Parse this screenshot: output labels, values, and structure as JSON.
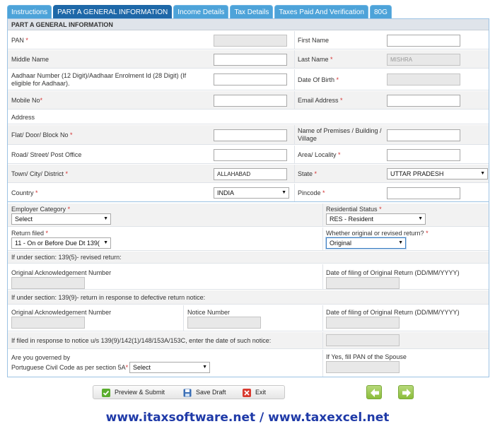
{
  "tabs": [
    "Instructions",
    "PART A GENERAL INFORMATION",
    "Income Details",
    "Tax Details",
    "Taxes Paid And Verification",
    "80G"
  ],
  "section_title": "PART A GENERAL INFORMATION",
  "fields": {
    "pan": {
      "label": "PAN",
      "value": "",
      "required": "*"
    },
    "first_name": {
      "label": "First Name",
      "value": ""
    },
    "middle_name": {
      "label": "Middle Name",
      "value": ""
    },
    "last_name": {
      "label": "Last Name",
      "value": "MISHRA",
      "required": "*"
    },
    "aadhaar": {
      "label": "Aadhaar Number (12 Digit)/Aadhaar Enrolment Id (28 Digit) (If eligible for Aadhaar).",
      "value": ""
    },
    "dob": {
      "label": "Date Of Birth",
      "value": "",
      "required": "*"
    },
    "mobile": {
      "label": "Mobile No",
      "value": "",
      "required": "*"
    },
    "email": {
      "label": "Email Address",
      "value": "",
      "required": "*"
    },
    "address_label": "Address",
    "flat": {
      "label": "Flat/ Door/ Block No",
      "value": "",
      "required": "*"
    },
    "premises": {
      "label": "Name of Premises / Building / Village",
      "value": ""
    },
    "road": {
      "label": "Road/ Street/ Post Office",
      "value": ""
    },
    "area": {
      "label": "Area/ Locality",
      "value": "",
      "required": "*"
    },
    "town": {
      "label": "Town/ City/ District",
      "value": "ALLAHABAD",
      "required": "*"
    },
    "state": {
      "label": "State",
      "value": "UTTAR PRADESH",
      "required": "*"
    },
    "country": {
      "label": "Country",
      "value": "INDIA",
      "required": "*"
    },
    "pincode": {
      "label": "Pincode",
      "value": "",
      "required": "*"
    }
  },
  "filing": {
    "employer_category": {
      "label": "Employer Category",
      "value": "Select",
      "required": "*"
    },
    "residential_status": {
      "label": "Residential Status",
      "value": "RES - Resident",
      "required": "*"
    },
    "return_filed": {
      "label": "Return filed",
      "value": "11 - On or Before Due Dt 139(",
      "required": "*"
    },
    "original_revised": {
      "label": "Whether original or revised return?",
      "value": "Original",
      "required": "*"
    },
    "revised_heading": "If under section: 139(5)- revised return:",
    "orig_ack": {
      "label": "Original Acknowledgement Number",
      "value": ""
    },
    "orig_date": {
      "label": "Date of filing of Original Return (DD/MM/YYYY)",
      "value": ""
    },
    "defective_heading": "If under section: 139(9)- return in response to defective return notice:",
    "orig_ack2": {
      "label": "Original Acknowledgement Number",
      "value": ""
    },
    "notice_number": {
      "label": "Notice Number",
      "value": ""
    },
    "orig_date2": {
      "label": "Date of filing of Original Return (DD/MM/YYYY)",
      "value": ""
    },
    "notice_date_label": "If filed in response to notice u/s 139(9)/142(1)/148/153A/153C, enter the date of such notice:",
    "portuguese": {
      "label_line1": "Are you governed by",
      "label_line2": "Portuguese Civil Code as per section 5A",
      "required": "*",
      "value": "Select"
    },
    "spouse_pan": {
      "label": "If Yes, fill PAN of the Spouse",
      "value": ""
    }
  },
  "toolbar": {
    "preview": "Preview & Submit",
    "save": "Save Draft",
    "exit": "Exit"
  },
  "footer": "www.itaxsoftware.net / www.taxexcel.net",
  "colors": {
    "tab": "#4da3d9",
    "tab_active": "#1e68a8",
    "footer_text": "#1f3aa8",
    "nav_green": "#8bbd3a"
  }
}
